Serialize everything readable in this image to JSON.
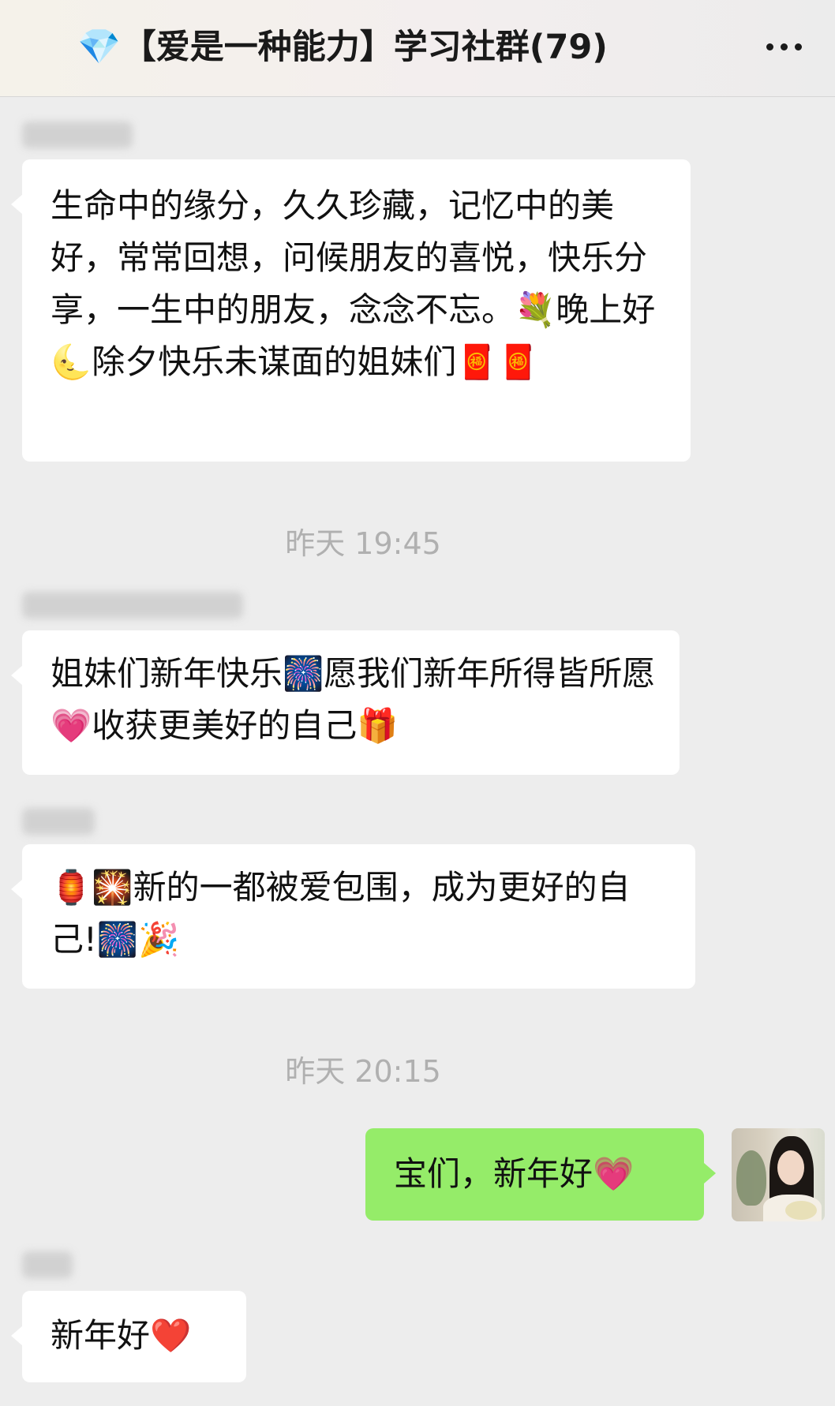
{
  "header": {
    "title_icon": "💎",
    "title": "【爱是一种能力】学习社群(79)",
    "more_icon": "more-dots-icon"
  },
  "messages": [
    {
      "direction": "in",
      "text": " 生命中的缘分，久久珍藏，记忆中的美好，常常回想，问候朋友的喜悦，快乐分享，一生中的朋友，念念不忘。💐晚上好🌜除夕快乐未谋面的姐妹们🧧🧧"
    },
    {
      "time": "昨天 19:45"
    },
    {
      "direction": "in",
      "text": "姐妹们新年快乐🎆愿我们新年所得皆所愿💗收获更美好的自己🎁"
    },
    {
      "direction": "in",
      "text": "🏮🎇新的一都被爱包围，成为更好的自己!🎆🎉"
    },
    {
      "time": "昨天 20:15"
    },
    {
      "direction": "out",
      "text": "宝们，新年好💗"
    },
    {
      "direction": "in",
      "text": "新年好❤️"
    }
  ],
  "colors": {
    "background": "#ededed",
    "incoming_bubble": "#ffffff",
    "outgoing_bubble": "#95ec69",
    "timestamp": "#b0b0b0"
  }
}
